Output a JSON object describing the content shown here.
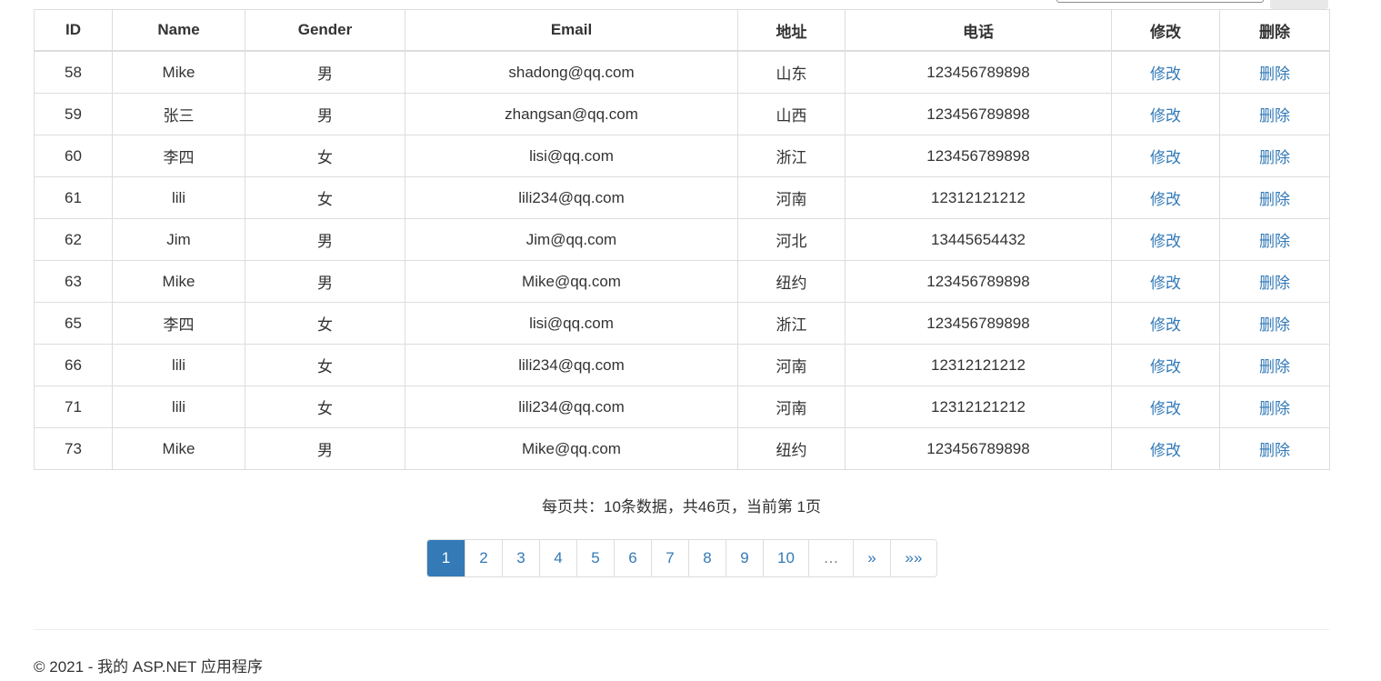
{
  "table": {
    "columns": [
      "ID",
      "Name",
      "Gender",
      "Email",
      "地址",
      "电话",
      "修改",
      "删除"
    ],
    "rows": [
      {
        "id": "58",
        "name": "Mike",
        "gender": "男",
        "email": "shadong@qq.com",
        "address": "山东",
        "phone": "123456789898",
        "edit": "修改",
        "delete": "删除"
      },
      {
        "id": "59",
        "name": "张三",
        "gender": "男",
        "email": "zhangsan@qq.com",
        "address": "山西",
        "phone": "123456789898",
        "edit": "修改",
        "delete": "删除"
      },
      {
        "id": "60",
        "name": "李四",
        "gender": "女",
        "email": "lisi@qq.com",
        "address": "浙江",
        "phone": "123456789898",
        "edit": "修改",
        "delete": "删除"
      },
      {
        "id": "61",
        "name": "lili",
        "gender": "女",
        "email": "lili234@qq.com",
        "address": "河南",
        "phone": "12312121212",
        "edit": "修改",
        "delete": "删除"
      },
      {
        "id": "62",
        "name": "Jim",
        "gender": "男",
        "email": "Jim@qq.com",
        "address": "河北",
        "phone": "13445654432",
        "edit": "修改",
        "delete": "删除"
      },
      {
        "id": "63",
        "name": "Mike",
        "gender": "男",
        "email": "Mike@qq.com",
        "address": "纽约",
        "phone": "123456789898",
        "edit": "修改",
        "delete": "删除"
      },
      {
        "id": "65",
        "name": "李四",
        "gender": "女",
        "email": "lisi@qq.com",
        "address": "浙江",
        "phone": "123456789898",
        "edit": "修改",
        "delete": "删除"
      },
      {
        "id": "66",
        "name": "lili",
        "gender": "女",
        "email": "lili234@qq.com",
        "address": "河南",
        "phone": "12312121212",
        "edit": "修改",
        "delete": "删除"
      },
      {
        "id": "71",
        "name": "lili",
        "gender": "女",
        "email": "lili234@qq.com",
        "address": "河南",
        "phone": "12312121212",
        "edit": "修改",
        "delete": "删除"
      },
      {
        "id": "73",
        "name": "Mike",
        "gender": "男",
        "email": "Mike@qq.com",
        "address": "纽约",
        "phone": "123456789898",
        "edit": "修改",
        "delete": "删除"
      }
    ]
  },
  "summary": "每页共：10条数据，共46页，当前第 1页",
  "pagination": {
    "pages": [
      "1",
      "2",
      "3",
      "4",
      "5",
      "6",
      "7",
      "8",
      "9",
      "10"
    ],
    "current": "1",
    "ellipsis": "…",
    "next": "»",
    "last": "»»"
  },
  "footer": "© 2021 - 我的 ASP.NET 应用程序",
  "colors": {
    "link": "#337ab7",
    "active_page_bg": "#337ab7",
    "border": "#dddddd",
    "text": "#333333"
  }
}
